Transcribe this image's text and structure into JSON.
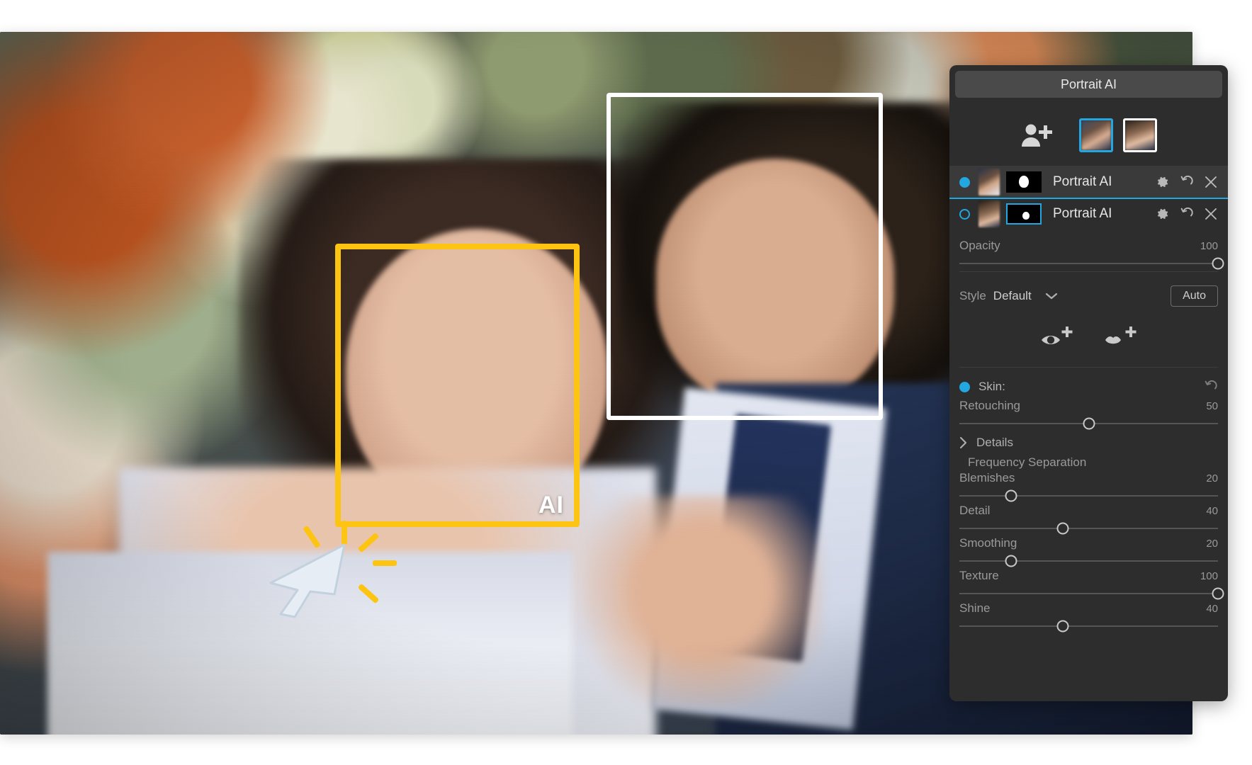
{
  "app": {
    "panel_title": "Portrait AI"
  },
  "canvas": {
    "ai_badge": "AI",
    "cursor_icon": "arrow-cursor-icon",
    "click_burst_icon": "click-burst-icon",
    "detections": [
      {
        "id": "face-male",
        "label": "male-face-detection-box",
        "color": "#ffffff",
        "selected": false
      },
      {
        "id": "face-female",
        "label": "female-face-detection-box",
        "color": "#fdc411",
        "selected": true
      }
    ]
  },
  "faces": {
    "add_face_icon": "add-person-icon",
    "thumbnails": [
      {
        "name": "face-thumbnail-1",
        "selected_color": "#22a7e0",
        "selected": true
      },
      {
        "name": "face-thumbnail-2",
        "selected_color": "#ffffff",
        "selected": false
      }
    ]
  },
  "layers": [
    {
      "name": "Portrait AI",
      "enabled": true,
      "active": false,
      "mask_selected": false,
      "actions": [
        "settings-icon",
        "reset-icon",
        "close-icon"
      ]
    },
    {
      "name": "Portrait AI",
      "enabled": false,
      "active": true,
      "mask_selected": true,
      "actions": [
        "settings-icon",
        "reset-icon",
        "close-icon"
      ]
    }
  ],
  "controls": {
    "opacity": {
      "label": "Opacity",
      "value": "100",
      "percent": 100
    },
    "style": {
      "label": "Style",
      "value": "Default",
      "caret_icon": "chevron-down-icon"
    },
    "auto_button": "Auto",
    "feature_icons": [
      {
        "name": "add-eye-icon",
        "tooltip": "Add Eye"
      },
      {
        "name": "add-lips-icon",
        "tooltip": "Add Lips"
      }
    ],
    "skin": {
      "label": "Skin:",
      "enabled": true,
      "reset_icon": "reset-icon"
    },
    "details": {
      "label": "Details",
      "expand_icon": "chevron-right-icon",
      "expanded": false
    },
    "frequency_separation": {
      "label": "Frequency Separation"
    },
    "sliders": [
      {
        "label": "Retouching",
        "value": "50",
        "percent": 50
      },
      {
        "label": "Blemishes",
        "value": "20",
        "percent": 20
      },
      {
        "label": "Detail",
        "value": "40",
        "percent": 40
      },
      {
        "label": "Smoothing",
        "value": "20",
        "percent": 20
      },
      {
        "label": "Texture",
        "value": "100",
        "percent": 100
      },
      {
        "label": "Shine",
        "value": "40",
        "percent": 40
      }
    ]
  },
  "colors": {
    "accent": "#22a7e0",
    "highlight": "#fdc411",
    "panel_bg": "#2d2d2d",
    "panel_header": "#4a4a4a",
    "layer_active_bg": "#3a3a3a"
  }
}
